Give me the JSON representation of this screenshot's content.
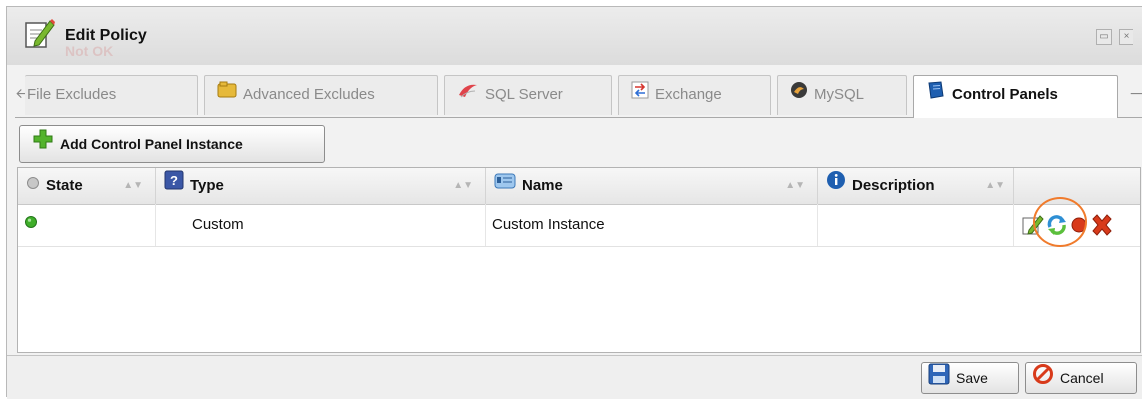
{
  "window": {
    "title": "Edit Policy",
    "ghost_text": "Not OK",
    "buttons": [
      "minimize-icon",
      "close-icon"
    ]
  },
  "tabs": {
    "left_arrow_icon": "arrow-left-icon",
    "right_arrow_icon": "arrow-right-icon",
    "items": [
      {
        "label": "File Excludes",
        "icon": "",
        "active": false
      },
      {
        "label": "Advanced Excludes",
        "icon": "folder-icon",
        "active": false
      },
      {
        "label": "SQL Server",
        "icon": "sql-server-icon",
        "active": false
      },
      {
        "label": "Exchange",
        "icon": "exchange-icon",
        "active": false
      },
      {
        "label": "MySQL",
        "icon": "mysql-dolphin-icon",
        "active": false
      },
      {
        "label": "Control Panels",
        "icon": "control-panel-icon",
        "active": true
      }
    ]
  },
  "toolbar": {
    "add_label": "Add Control Panel Instance",
    "add_icon": "add-plus-icon"
  },
  "grid": {
    "columns": [
      {
        "label": "State",
        "icon": "state-dot-icon"
      },
      {
        "label": "Type",
        "icon": "type-question-icon"
      },
      {
        "label": "Name",
        "icon": "name-card-icon"
      },
      {
        "label": "Description",
        "icon": "info-icon"
      },
      {
        "label": "",
        "icon": ""
      }
    ],
    "rows": [
      {
        "state": "active",
        "state_color": "#3fae2a",
        "type": "Custom",
        "name": "Custom Instance",
        "description": "",
        "actions": [
          "edit-icon",
          "refresh-icon",
          "stop-icon",
          "delete-icon"
        ]
      }
    ]
  },
  "footer": {
    "save_label": "Save",
    "cancel_label": "Cancel"
  },
  "colors": {
    "highlight": "#f07b2c",
    "active_state": "#3fae2a",
    "delete": "#d83a1a"
  }
}
